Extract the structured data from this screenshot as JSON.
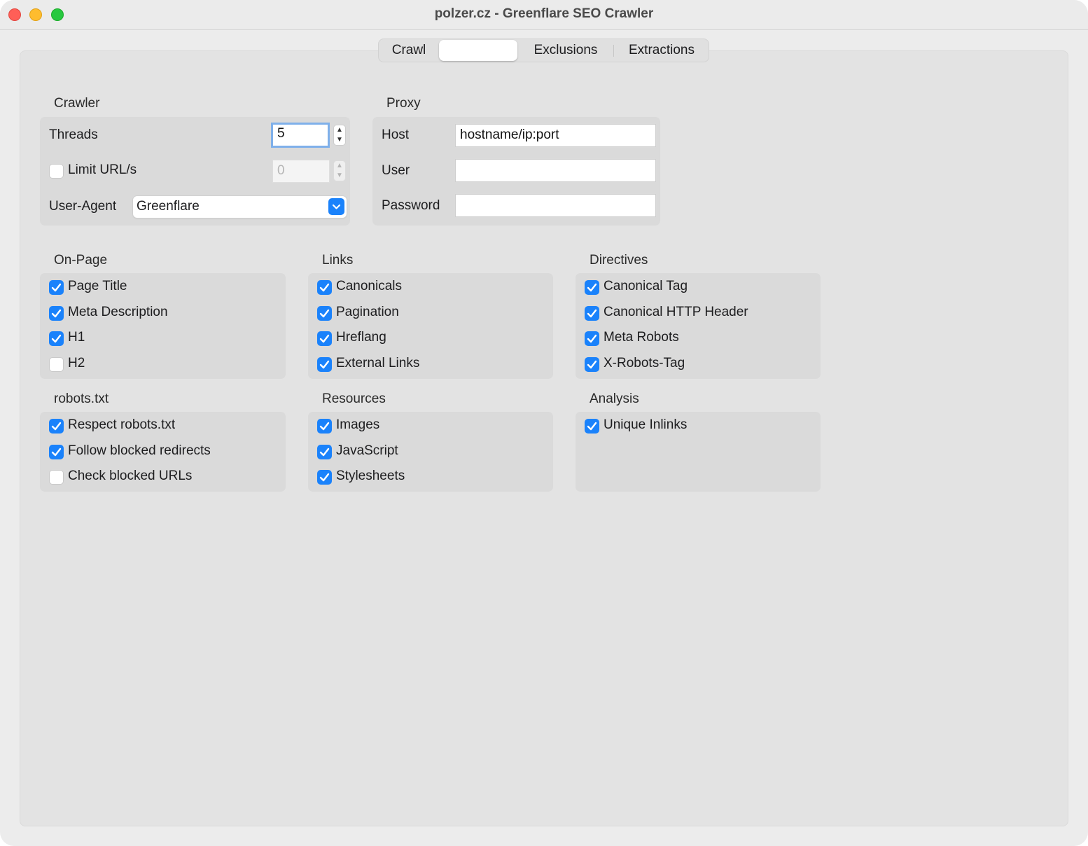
{
  "window": {
    "title": "polzer.cz - Greenflare SEO Crawler"
  },
  "tabs": [
    {
      "label": "Crawl"
    },
    {
      "label": ""
    },
    {
      "label": "Exclusions"
    },
    {
      "label": "Extractions"
    }
  ],
  "crawler": {
    "title": "Crawler",
    "threads_label": "Threads",
    "threads_value": "5",
    "limit_label": "Limit URL/s",
    "limit_checked": false,
    "limit_value": "0",
    "useragent_label": "User-Agent",
    "useragent_value": "Greenflare"
  },
  "proxy": {
    "title": "Proxy",
    "host_label": "Host",
    "host_value": "hostname/ip:port",
    "user_label": "User",
    "user_value": "",
    "password_label": "Password",
    "password_value": ""
  },
  "onpage": {
    "title": "On-Page",
    "items": [
      {
        "label": "Page Title",
        "checked": true
      },
      {
        "label": "Meta Description",
        "checked": true
      },
      {
        "label": "H1",
        "checked": true
      },
      {
        "label": "H2",
        "checked": false
      }
    ]
  },
  "links": {
    "title": "Links",
    "items": [
      {
        "label": "Canonicals",
        "checked": true
      },
      {
        "label": "Pagination",
        "checked": true
      },
      {
        "label": "Hreflang",
        "checked": true
      },
      {
        "label": "External Links",
        "checked": true
      }
    ]
  },
  "directives": {
    "title": "Directives",
    "items": [
      {
        "label": "Canonical Tag",
        "checked": true
      },
      {
        "label": "Canonical HTTP Header",
        "checked": true
      },
      {
        "label": "Meta Robots",
        "checked": true
      },
      {
        "label": "X-Robots-Tag",
        "checked": true
      }
    ]
  },
  "robots": {
    "title": "robots.txt",
    "items": [
      {
        "label": "Respect robots.txt",
        "checked": true
      },
      {
        "label": "Follow blocked redirects",
        "checked": true
      },
      {
        "label": "Check blocked URLs",
        "checked": false
      }
    ]
  },
  "resources": {
    "title": "Resources",
    "items": [
      {
        "label": "Images",
        "checked": true
      },
      {
        "label": "JavaScript",
        "checked": true
      },
      {
        "label": "Stylesheets",
        "checked": true
      }
    ]
  },
  "analysis": {
    "title": "Analysis",
    "items": [
      {
        "label": "Unique Inlinks",
        "checked": true
      }
    ]
  },
  "colors": {
    "accent": "#1a82fb",
    "window_bg": "#ececec",
    "panel_bg": "#e3e3e3",
    "group_bg": "#dadada"
  },
  "icons": {
    "checkbox_checked": "checkmark-icon",
    "stepper": "chevron-up-down-icon",
    "select": "chevron-down-icon"
  }
}
